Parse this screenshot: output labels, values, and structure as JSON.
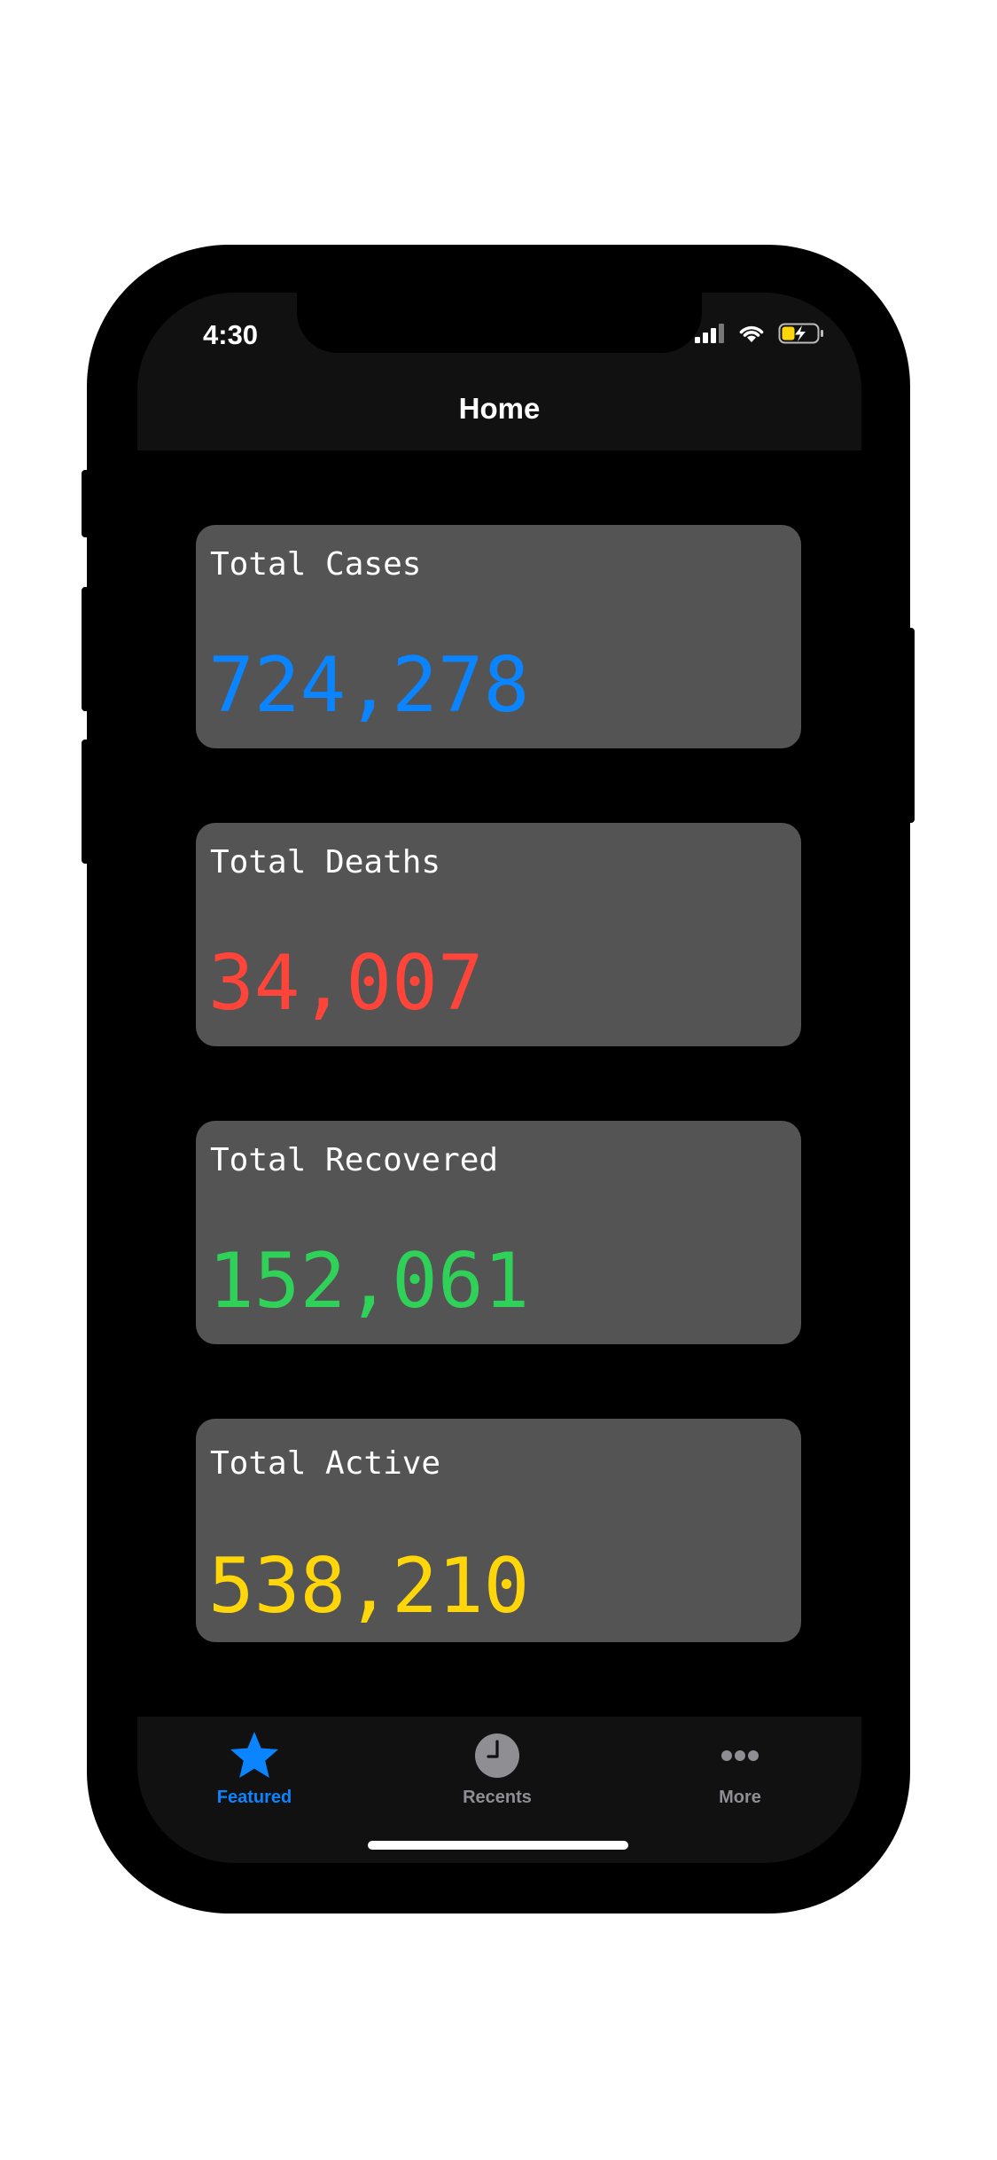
{
  "status_bar": {
    "time": "4:30",
    "battery_color": "#FFD60A"
  },
  "nav": {
    "title": "Home"
  },
  "cards": [
    {
      "label": "Total Cases",
      "value": "724,278",
      "color": "#0A84FF"
    },
    {
      "label": "Total Deaths",
      "value": "34,007",
      "color": "#FF453A"
    },
    {
      "label": "Total Recovered",
      "value": "152,061",
      "color": "#30D158"
    },
    {
      "label": "Total Active",
      "value": "538,210",
      "color": "#FFD60A"
    }
  ],
  "tabs": [
    {
      "label": "Featured",
      "icon": "star-icon",
      "selected": true
    },
    {
      "label": "Recents",
      "icon": "clock-icon",
      "selected": false
    },
    {
      "label": "More",
      "icon": "more-icon",
      "selected": false
    }
  ],
  "colors": {
    "accent": "#0A84FF",
    "tab_inactive": "#8E8E93",
    "card_bg": "#545454",
    "bar_bg": "#111111"
  }
}
